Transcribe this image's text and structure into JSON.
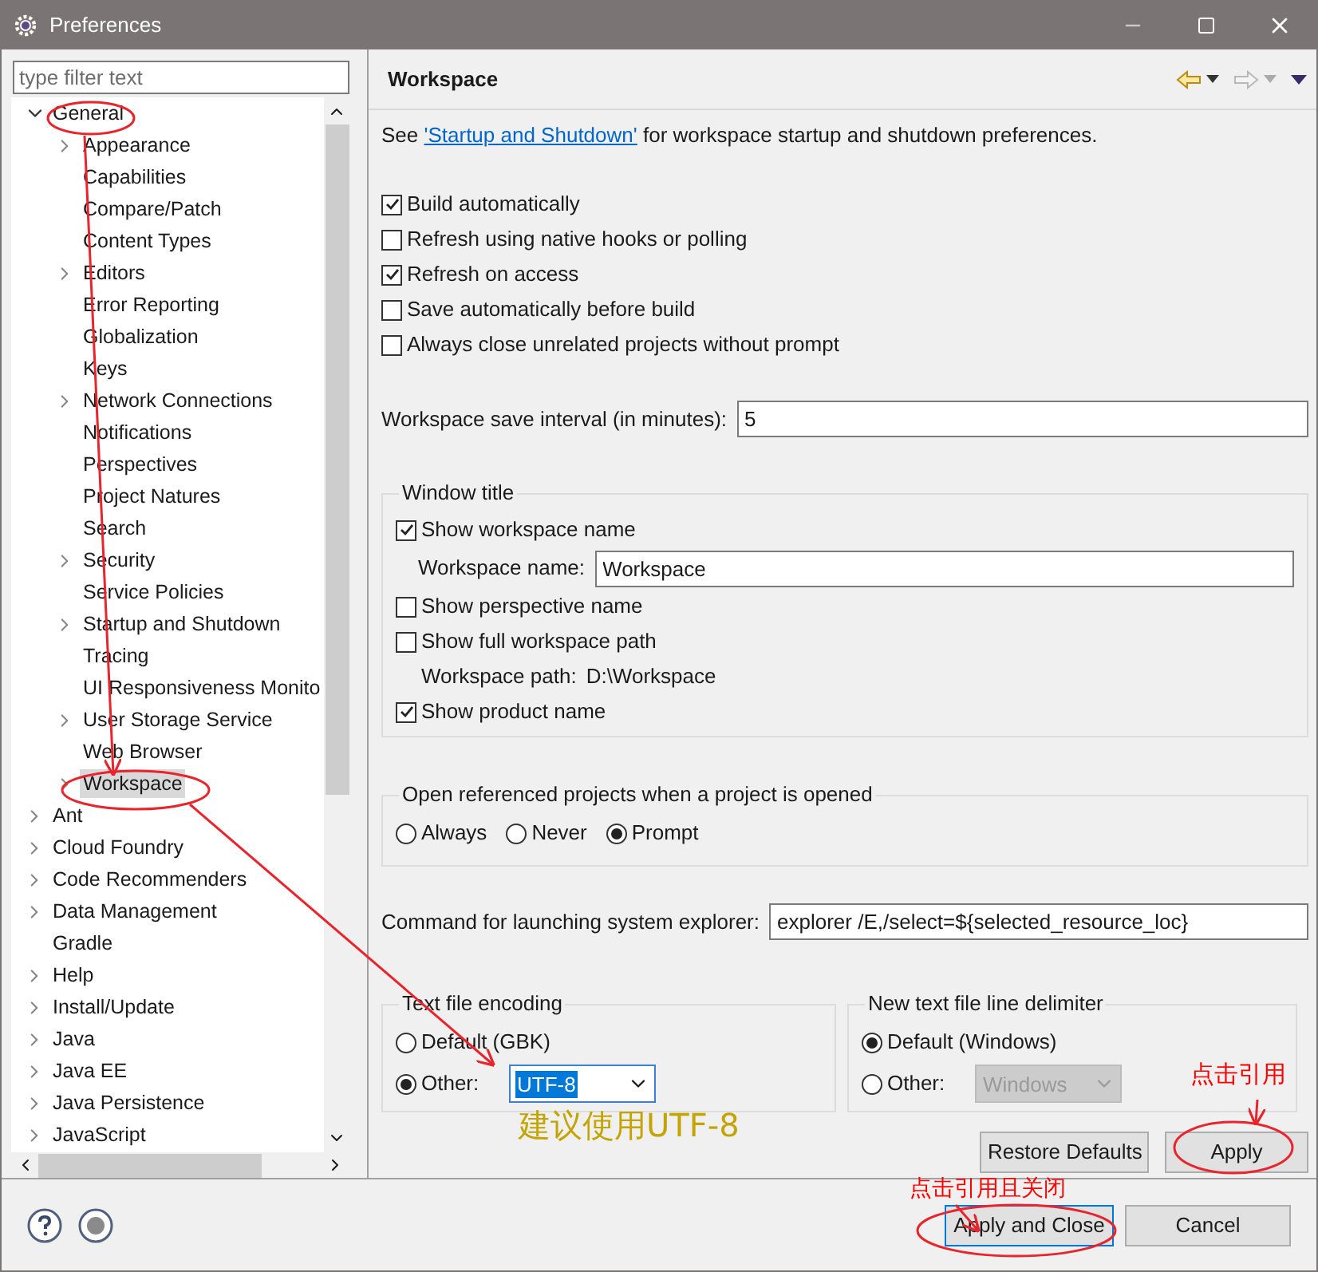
{
  "window": {
    "title": "Preferences"
  },
  "filter": {
    "placeholder": "type filter text"
  },
  "tree": [
    {
      "label": "General",
      "expandable": true,
      "expanded": true,
      "selected": false,
      "children": [
        {
          "label": "Appearance",
          "expandable": true,
          "expanded": false,
          "selected": false
        },
        {
          "label": "Capabilities",
          "expandable": false,
          "selected": false
        },
        {
          "label": "Compare/Patch",
          "expandable": false,
          "selected": false
        },
        {
          "label": "Content Types",
          "expandable": false,
          "selected": false
        },
        {
          "label": "Editors",
          "expandable": true,
          "expanded": false,
          "selected": false
        },
        {
          "label": "Error Reporting",
          "expandable": false,
          "selected": false
        },
        {
          "label": "Globalization",
          "expandable": false,
          "selected": false
        },
        {
          "label": "Keys",
          "expandable": false,
          "selected": false
        },
        {
          "label": "Network Connections",
          "expandable": true,
          "expanded": false,
          "selected": false
        },
        {
          "label": "Notifications",
          "expandable": false,
          "selected": false
        },
        {
          "label": "Perspectives",
          "expandable": false,
          "selected": false
        },
        {
          "label": "Project Natures",
          "expandable": false,
          "selected": false
        },
        {
          "label": "Search",
          "expandable": false,
          "selected": false
        },
        {
          "label": "Security",
          "expandable": true,
          "expanded": false,
          "selected": false
        },
        {
          "label": "Service Policies",
          "expandable": false,
          "selected": false
        },
        {
          "label": "Startup and Shutdown",
          "expandable": true,
          "expanded": false,
          "selected": false
        },
        {
          "label": "Tracing",
          "expandable": false,
          "selected": false
        },
        {
          "label": "UI Responsiveness Monito",
          "expandable": false,
          "selected": false
        },
        {
          "label": "User Storage Service",
          "expandable": true,
          "expanded": false,
          "selected": false
        },
        {
          "label": "Web Browser",
          "expandable": false,
          "selected": false
        },
        {
          "label": "Workspace",
          "expandable": true,
          "expanded": false,
          "selected": true
        }
      ]
    },
    {
      "label": "Ant",
      "expandable": true,
      "expanded": false,
      "selected": false
    },
    {
      "label": "Cloud Foundry",
      "expandable": true,
      "expanded": false,
      "selected": false
    },
    {
      "label": "Code Recommenders",
      "expandable": true,
      "expanded": false,
      "selected": false
    },
    {
      "label": "Data Management",
      "expandable": true,
      "expanded": false,
      "selected": false
    },
    {
      "label": "Gradle",
      "expandable": false,
      "selected": false
    },
    {
      "label": "Help",
      "expandable": true,
      "expanded": false,
      "selected": false
    },
    {
      "label": "Install/Update",
      "expandable": true,
      "expanded": false,
      "selected": false
    },
    {
      "label": "Java",
      "expandable": true,
      "expanded": false,
      "selected": false
    },
    {
      "label": "Java EE",
      "expandable": true,
      "expanded": false,
      "selected": false
    },
    {
      "label": "Java Persistence",
      "expandable": true,
      "expanded": false,
      "selected": false
    },
    {
      "label": "JavaScript",
      "expandable": true,
      "expanded": false,
      "selected": false
    }
  ],
  "page": {
    "title": "Workspace",
    "intro_before": "See ",
    "intro_link": "'Startup and Shutdown'",
    "intro_after": " for workspace startup and shutdown preferences.",
    "options": [
      {
        "label": "Build automatically",
        "checked": true
      },
      {
        "label": "Refresh using native hooks or polling",
        "checked": false
      },
      {
        "label": "Refresh on access",
        "checked": true
      },
      {
        "label": "Save automatically before build",
        "checked": false
      },
      {
        "label": "Always close unrelated projects without prompt",
        "checked": false
      }
    ],
    "save_interval": {
      "label": "Workspace save interval (in minutes):",
      "value": "5"
    },
    "window_title": {
      "title": "Window title",
      "rows": [
        {
          "kind": "checkbox",
          "label": "Show workspace name",
          "checked": true
        },
        {
          "kind": "field",
          "label": "Workspace name:",
          "value": "Workspace"
        },
        {
          "kind": "checkbox",
          "label": "Show perspective name",
          "checked": false
        },
        {
          "kind": "checkbox",
          "label": "Show full workspace path",
          "checked": false
        },
        {
          "kind": "info",
          "label": "Workspace path:",
          "value": "D:\\Workspace"
        },
        {
          "kind": "checkbox",
          "label": "Show product name",
          "checked": true
        }
      ]
    },
    "open_referenced": {
      "title": "Open referenced projects when a project is opened",
      "options": [
        {
          "label": "Always",
          "selected": false
        },
        {
          "label": "Never",
          "selected": false
        },
        {
          "label": "Prompt",
          "selected": true
        }
      ]
    },
    "explorer_command": {
      "label": "Command for launching system explorer:",
      "value": "explorer /E,/select=${selected_resource_loc}"
    },
    "encoding": {
      "title": "Text file encoding",
      "options": [
        {
          "label": "Default (GBK)",
          "selected": false
        },
        {
          "label": "Other:",
          "selected": true
        }
      ],
      "value": "UTF-8",
      "disabled": false,
      "highlighted": true
    },
    "line_delimiter": {
      "title": "New text file line delimiter",
      "options": [
        {
          "label": "Default (Windows)",
          "selected": true
        },
        {
          "label": "Other:",
          "selected": false
        }
      ],
      "value": "Windows",
      "disabled": true,
      "highlighted": false
    },
    "buttons": [
      "Restore Defaults",
      "Apply"
    ]
  },
  "footer": {
    "buttons": [
      {
        "label": "Apply and Close",
        "default": true
      },
      {
        "label": "Cancel",
        "default": false
      }
    ]
  },
  "notes": [
    {
      "text": "建议使用UTF-8",
      "color": "#c4a400"
    },
    {
      "text": "点击引用",
      "color": "#ff0000"
    },
    {
      "text": "点击引用且关闭",
      "color": "#ff0000"
    }
  ]
}
